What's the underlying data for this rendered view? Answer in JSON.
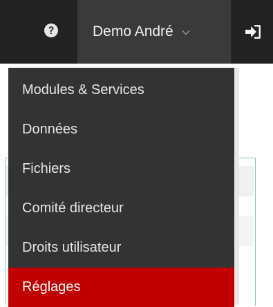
{
  "topbar": {
    "help_icon": "question-circle-icon",
    "user_name": "Demo André",
    "user_chevron_icon": "chevron-down-icon",
    "logout_icon": "sign-in-icon"
  },
  "menu": {
    "items": [
      {
        "label": "Modules & Services",
        "active": false
      },
      {
        "label": "Données",
        "active": false
      },
      {
        "label": "Fichiers",
        "active": false
      },
      {
        "label": "Comité directeur",
        "active": false
      },
      {
        "label": "Droits utilisateur",
        "active": false
      },
      {
        "label": "Réglages",
        "active": true
      }
    ]
  },
  "colors": {
    "topbar": "#222222",
    "toggle": "#3a3a3a",
    "dropdown": "#333333",
    "active": "#c00000",
    "panel_border": "#7fc6c6"
  }
}
